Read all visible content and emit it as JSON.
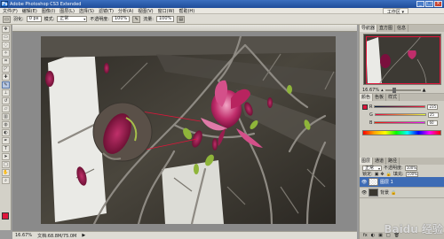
{
  "titlebar": {
    "logo": "Ps",
    "title": "Adobe Photoshop CS3 Extended",
    "min": "_",
    "max": "□",
    "close": "×"
  },
  "menubar": {
    "items": [
      "文件(F)",
      "编辑(E)",
      "图像(I)",
      "图层(L)",
      "选择(S)",
      "滤镜(T)",
      "分析(A)",
      "视图(V)",
      "窗口(W)",
      "帮助(H)"
    ],
    "workspace": "工作区 ▾"
  },
  "options": {
    "feather_label": "羽化:",
    "feather_value": "0 px",
    "mode_label": "模式:",
    "mode_value": "正常",
    "opacity_label": "不透明度:",
    "opacity_value": "100%",
    "flow_label": "流量:",
    "flow_value": "100%"
  },
  "document": {
    "tab_title": ""
  },
  "status": {
    "zoom": "16.67%",
    "doc": "文档:68.8M/75.0M",
    "arrow": "▶"
  },
  "navigator": {
    "tabs": [
      "导航器",
      "直方图",
      "信息"
    ],
    "zoom_value": "16.67%"
  },
  "color": {
    "tabs": [
      "颜色",
      "色板",
      "样式"
    ],
    "rows": [
      {
        "label": "R",
        "value": "235"
      },
      {
        "label": "G",
        "value": "25"
      },
      {
        "label": "B",
        "value": "60"
      }
    ]
  },
  "layers": {
    "tabs": [
      "图层",
      "通道",
      "路径"
    ],
    "blend": "正常",
    "opacity_label": "不透明度:",
    "opacity": "100%",
    "lock_label": "锁定:",
    "fill_label": "填充:",
    "fill": "100%",
    "items": [
      {
        "name": "图层 1"
      },
      {
        "name": "背景"
      }
    ],
    "footer": [
      "fx",
      "◐",
      "▣",
      "□",
      "🗑"
    ]
  },
  "watermark": "Baidu 经验",
  "colors": {
    "fg": "#e0153b",
    "accent": "#3d6bb5"
  }
}
